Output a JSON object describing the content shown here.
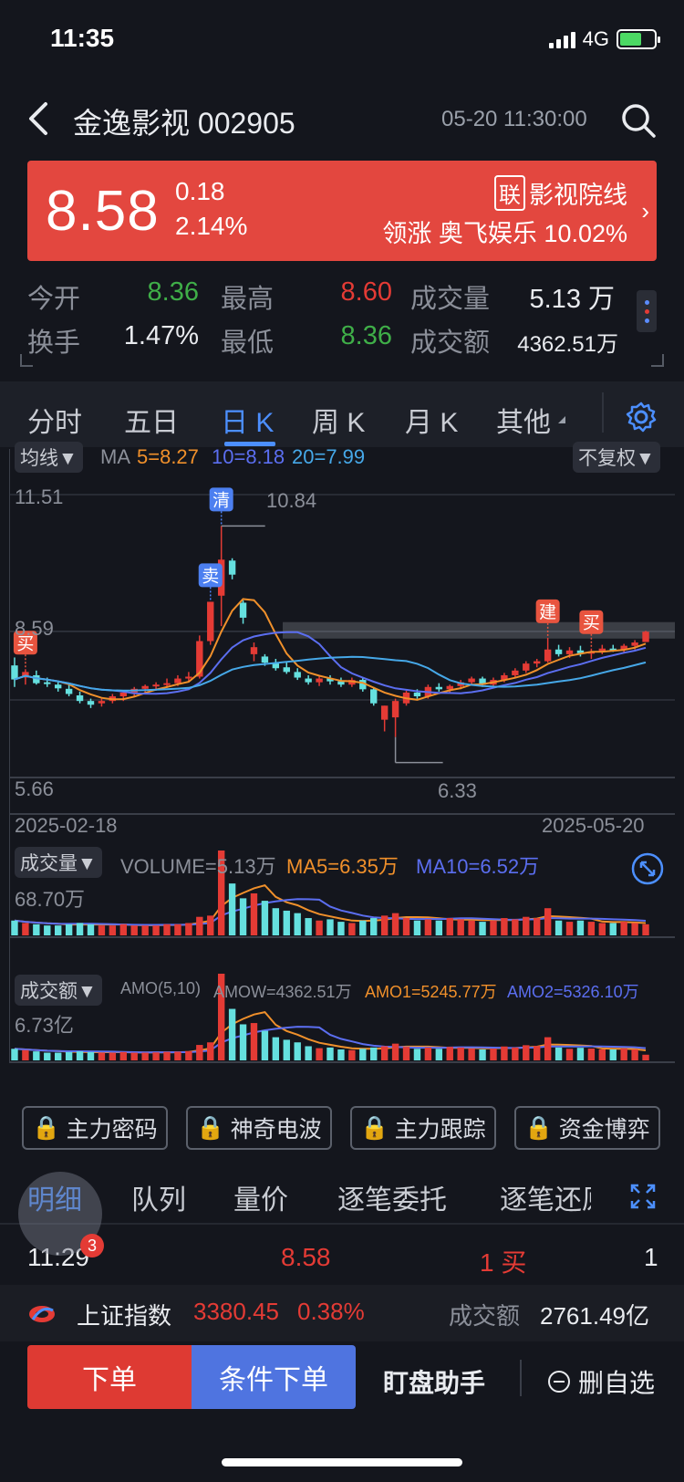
{
  "status_bar": {
    "time": "11:35",
    "network": "4G",
    "battery_level": 0.65
  },
  "header": {
    "title": "金逸影视 002905",
    "datetime": "05-20 11:30:00"
  },
  "banner": {
    "price": "8.58",
    "change": "0.18",
    "change_pct": "2.14%",
    "sector_tag": "联",
    "sector_name": "影视院线",
    "leader": "领涨 奥飞娱乐 10.02%"
  },
  "quotes": [
    {
      "label": "今开",
      "value": "8.36",
      "color": "#3fae48"
    },
    {
      "label": "最高",
      "value": "8.60",
      "color": "#e43b35"
    },
    {
      "label": "成交量",
      "value": "5.13 万",
      "color": "#e9ebef"
    },
    {
      "label": "换手",
      "value": "1.47%",
      "color": "#e9ebef"
    },
    {
      "label": "最低",
      "value": "8.36",
      "color": "#3fae48"
    },
    {
      "label": "成交额",
      "value": "4362.51万",
      "color": "#e9ebef"
    }
  ],
  "tabs": [
    "分时",
    "五日",
    "日 K",
    "周 K",
    "月 K",
    "其他"
  ],
  "chart_data": {
    "type": "candlestick",
    "indicator_pill": "均线",
    "ma_label": "MA",
    "ma5": "5=8.27",
    "ma10": "10=8.18",
    "ma20": "20=7.99",
    "adjust_pill": "不复权",
    "y_top": "11.51",
    "y_mid": "8.59",
    "y_bottom": "5.66",
    "high_label": "10.84",
    "low_label": "6.33",
    "x_start": "2025-02-18",
    "x_end": "2025-05-20",
    "ylim": [
      5.66,
      11.51
    ],
    "signals": [
      "买",
      "卖",
      "清",
      "建",
      "买"
    ],
    "colors": {
      "up": "#e43b35",
      "down": "#65e0df",
      "ma5": "#f0902b",
      "ma10": "#5b6ef0",
      "ma20": "#46a8e8"
    },
    "candles": [
      [
        7.86,
        8.03,
        7.4,
        7.56
      ],
      [
        7.6,
        7.78,
        7.45,
        7.72
      ],
      [
        7.65,
        7.75,
        7.45,
        7.48
      ],
      [
        7.5,
        7.6,
        7.4,
        7.47
      ],
      [
        7.45,
        7.52,
        7.3,
        7.37
      ],
      [
        7.36,
        7.45,
        7.2,
        7.25
      ],
      [
        7.22,
        7.3,
        7.05,
        7.1
      ],
      [
        7.1,
        7.15,
        6.95,
        7.02
      ],
      [
        7.05,
        7.15,
        6.98,
        7.1
      ],
      [
        7.1,
        7.25,
        7.05,
        7.2
      ],
      [
        7.2,
        7.32,
        7.1,
        7.28
      ],
      [
        7.28,
        7.4,
        7.2,
        7.36
      ],
      [
        7.36,
        7.45,
        7.28,
        7.42
      ],
      [
        7.42,
        7.5,
        7.32,
        7.45
      ],
      [
        7.45,
        7.58,
        7.38,
        7.48
      ],
      [
        7.48,
        7.65,
        7.42,
        7.58
      ],
      [
        7.58,
        7.72,
        7.5,
        7.62
      ],
      [
        7.62,
        8.5,
        7.58,
        8.38
      ],
      [
        8.38,
        9.22,
        8.3,
        9.22
      ],
      [
        9.35,
        10.84,
        8.7,
        10.12
      ],
      [
        10.1,
        10.15,
        9.7,
        9.8
      ],
      [
        9.2,
        9.25,
        8.75,
        8.88
      ],
      [
        8.1,
        8.35,
        7.95,
        8.25
      ],
      [
        8.05,
        8.1,
        7.85,
        7.92
      ],
      [
        7.92,
        8.0,
        7.75,
        7.8
      ],
      [
        7.82,
        7.95,
        7.68,
        7.72
      ],
      [
        7.72,
        7.8,
        7.55,
        7.6
      ],
      [
        7.58,
        7.65,
        7.45,
        7.5
      ],
      [
        7.5,
        7.62,
        7.42,
        7.58
      ],
      [
        7.58,
        7.65,
        7.45,
        7.52
      ],
      [
        7.52,
        7.6,
        7.4,
        7.45
      ],
      [
        7.45,
        7.6,
        7.4,
        7.55
      ],
      [
        7.55,
        7.6,
        7.3,
        7.35
      ],
      [
        7.35,
        7.4,
        7.0,
        7.05
      ],
      [
        6.7,
        7.0,
        6.45,
        7.0
      ],
      [
        6.75,
        7.15,
        6.33,
        7.1
      ],
      [
        7.05,
        7.32,
        7.0,
        7.28
      ],
      [
        7.28,
        7.35,
        7.15,
        7.2
      ],
      [
        7.2,
        7.45,
        7.15,
        7.4
      ],
      [
        7.4,
        7.48,
        7.3,
        7.35
      ],
      [
        7.35,
        7.45,
        7.28,
        7.42
      ],
      [
        7.42,
        7.55,
        7.35,
        7.5
      ],
      [
        7.5,
        7.62,
        7.45,
        7.58
      ],
      [
        7.58,
        7.62,
        7.4,
        7.45
      ],
      [
        7.45,
        7.6,
        7.4,
        7.55
      ],
      [
        7.55,
        7.7,
        7.5,
        7.65
      ],
      [
        7.65,
        7.8,
        7.6,
        7.75
      ],
      [
        7.75,
        7.95,
        7.7,
        7.9
      ],
      [
        7.9,
        8.0,
        7.82,
        7.95
      ],
      [
        7.95,
        8.45,
        7.92,
        8.2
      ],
      [
        8.2,
        8.3,
        8.05,
        8.1
      ],
      [
        8.1,
        8.25,
        8.02,
        8.18
      ],
      [
        8.18,
        8.28,
        8.05,
        8.12
      ],
      [
        8.12,
        8.22,
        8.0,
        8.15
      ],
      [
        8.15,
        8.3,
        8.1,
        8.22
      ],
      [
        8.22,
        8.3,
        8.15,
        8.2
      ],
      [
        8.2,
        8.32,
        8.12,
        8.28
      ],
      [
        8.28,
        8.4,
        8.2,
        8.35
      ],
      [
        8.36,
        8.6,
        8.36,
        8.58
      ]
    ],
    "volume": {
      "pill": "成交量",
      "label": "VOLUME=5.13万",
      "ma5": "MA5=6.35万",
      "ma10": "MA10=6.52万",
      "y_top": "68.70万",
      "max": 68.7,
      "values": [
        12,
        10,
        9,
        8,
        8,
        9,
        10,
        9,
        8,
        8,
        9,
        8,
        8,
        8,
        9,
        9,
        10,
        15,
        16,
        68.7,
        42,
        30,
        34,
        28,
        22,
        20,
        18,
        14,
        12,
        13,
        11,
        10,
        12,
        14,
        16,
        18,
        14,
        12,
        13,
        12,
        14,
        13,
        12,
        11,
        12,
        14,
        13,
        15,
        14,
        22,
        12,
        11,
        12,
        11,
        10,
        10,
        11,
        10,
        9
      ]
    },
    "amount": {
      "pill": "成交额",
      "label1": "AMO(5,10)",
      "label2": "AMOW=4362.51万",
      "amo1": "AMO1=5245.77万",
      "amo2": "AMO2=5326.10万",
      "y_top": "6.73亿",
      "max": 6.73,
      "values": [
        0.9,
        0.8,
        0.7,
        0.6,
        0.6,
        0.65,
        0.7,
        0.65,
        0.6,
        0.6,
        0.65,
        0.6,
        0.6,
        0.62,
        0.66,
        0.68,
        0.72,
        1.2,
        1.4,
        6.73,
        4.0,
        2.8,
        2.9,
        2.3,
        1.8,
        1.6,
        1.4,
        1.1,
        0.95,
        1.0,
        0.85,
        0.8,
        0.9,
        1.0,
        1.1,
        1.3,
        1.05,
        0.9,
        1.0,
        0.9,
        1.05,
        1.0,
        0.92,
        0.85,
        0.92,
        1.08,
        1.0,
        1.18,
        1.12,
        1.8,
        1.0,
        0.9,
        0.98,
        0.92,
        0.85,
        0.85,
        0.92,
        0.85,
        0.44
      ]
    }
  },
  "features": [
    "主力密码",
    "神奇电波",
    "主力跟踪",
    "资金博弈"
  ],
  "bottom_tabs": [
    "明细",
    "队列",
    "量价",
    "逐笔委托",
    "逐笔还原"
  ],
  "trade": {
    "time": "11:29",
    "price": "8.58",
    "vol": "1 买",
    "count": "1"
  },
  "float_badge": "3",
  "index_row": {
    "name": "上证指数",
    "value": "3380.45",
    "pct": "0.38%",
    "amount_label": "成交额",
    "amount": "2761.49亿"
  },
  "bottom_bar": {
    "order": "下单",
    "cond_order": "条件下单",
    "assist": "盯盘助手",
    "remove": "删自选"
  }
}
